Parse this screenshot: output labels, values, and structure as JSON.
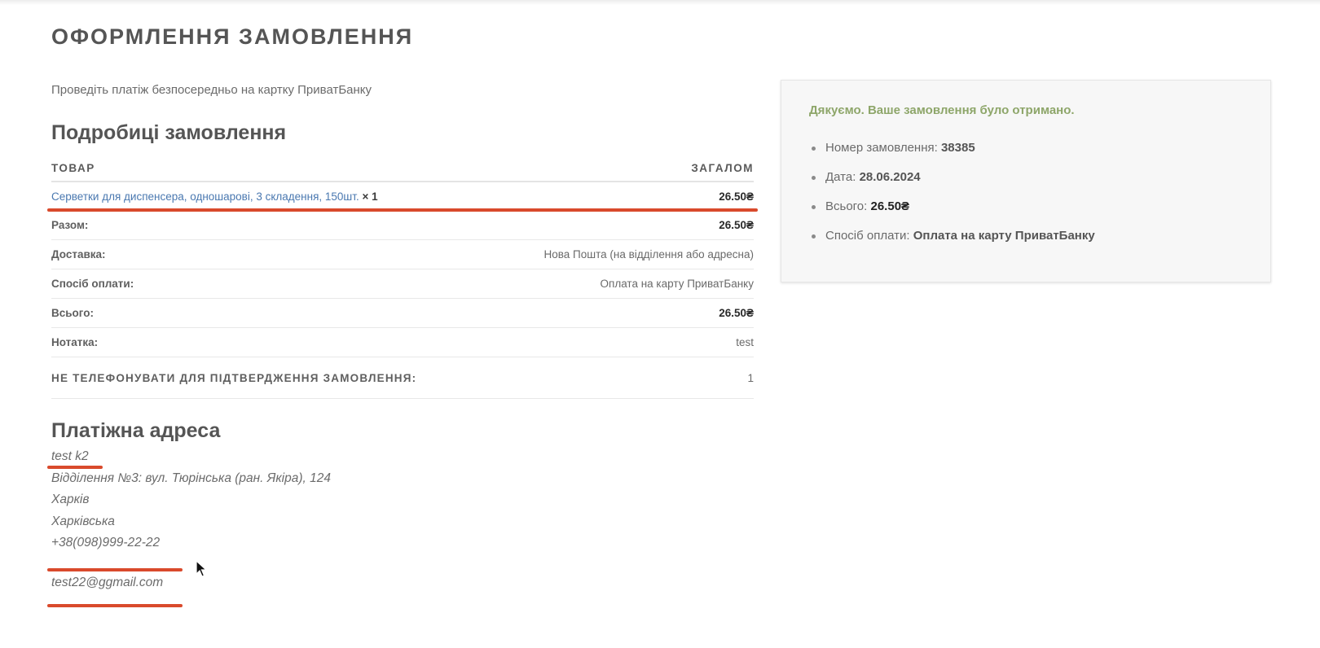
{
  "page": {
    "title": "ОФОРМЛЕННЯ ЗАМОВЛЕННЯ",
    "intro": "Проведіть платіж безпосередньо на картку ПриватБанку"
  },
  "order_details": {
    "heading": "Подробиці замовлення",
    "col_product": "ТОВАР",
    "col_total": "ЗАГАЛОМ",
    "item": {
      "name": "Серветки для диспенсера, одношарові, 3 складення, 150шт.",
      "qty": "× 1",
      "price": "26.50₴"
    },
    "rows": [
      {
        "label": "Разом:",
        "value": "26.50₴"
      },
      {
        "label": "Доставка:",
        "value": "Нова Пошта (на відділення або адресна)"
      },
      {
        "label": "Спосіб оплати:",
        "value": "Оплата на карту ПриватБанку"
      },
      {
        "label": "Всього:",
        "value": "26.50₴"
      },
      {
        "label": "Нотатка:",
        "value": "test"
      }
    ],
    "dont_call": {
      "label": "НЕ ТЕЛЕФОНУВАТИ ДЛЯ ПІДТВЕРДЖЕННЯ ЗАМОВЛЕННЯ:",
      "value": "1"
    }
  },
  "billing": {
    "heading": "Платіжна адреса",
    "name": "test k2",
    "branch": "Відділення №3: вул. Тюрінська (ран. Якіра), 124",
    "city": "Харків",
    "region": "Харківська",
    "phone": "+38(098)999-22-22",
    "email": "test22@ggmail.com"
  },
  "thank_you": {
    "message": "Дякуємо. Ваше замовлення було отримано.",
    "order_number_label": "Номер замовлення:",
    "order_number": "38385",
    "date_label": "Дата:",
    "date": "28.06.2024",
    "total_label": "Всього:",
    "total": "26.50₴",
    "payment_label": "Спосіб оплати:",
    "payment": "Оплата на карту ПриватБанку"
  },
  "colors": {
    "link": "#4a78b0",
    "success": "#8ea66a",
    "highlight": "#d94a2c"
  },
  "icons": {
    "cursor": "mouse-pointer-icon"
  }
}
